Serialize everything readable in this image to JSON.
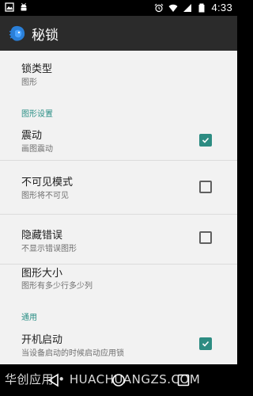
{
  "status": {
    "time": "4:33"
  },
  "appbar": {
    "title": "秘锁"
  },
  "settings": {
    "lock_type": {
      "title": "锁类型",
      "summary": "图形"
    },
    "section_pattern": "图形设置",
    "vibrate": {
      "title": "震动",
      "summary": "画图震动",
      "checked": true
    },
    "invisible": {
      "title": "不可见模式",
      "summary": "图形将不可见",
      "checked": false
    },
    "hide_error": {
      "title": "隐藏错误",
      "summary": "不显示错误图形",
      "checked": false
    },
    "pattern_size": {
      "title": "图形大小",
      "summary": "图形有多少行多少列"
    },
    "section_general": "通用",
    "autostart": {
      "title": "开机启动",
      "summary": "当设备启动的时候启动应用锁",
      "checked": true
    }
  },
  "watermark": "华创应用 • HUACHUANGZS.COM",
  "colors": {
    "accent": "#2d8c82",
    "appbar": "#2b2b2b",
    "background": "#f2f2f2"
  }
}
